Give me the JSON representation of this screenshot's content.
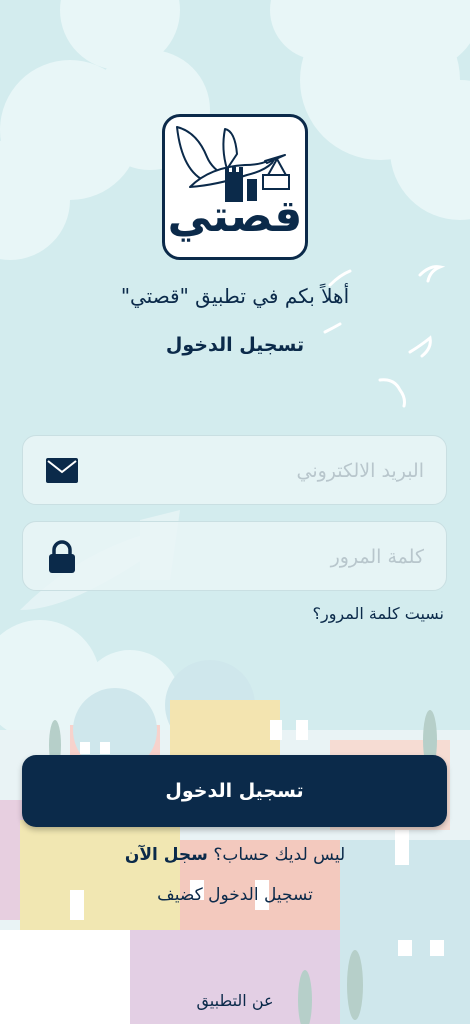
{
  "logo": {
    "text": "قصتي",
    "icon": "stork-carrying-book-logo"
  },
  "welcome_text": "أهلاً بكم في تطبيق \"قصتي\"",
  "login_title": "تسجيل الدخول",
  "email": {
    "placeholder": "البريد الالكتروني",
    "value": "",
    "icon": "envelope-icon"
  },
  "password": {
    "placeholder": "كلمة المرور",
    "value": "",
    "icon": "lock-icon"
  },
  "forgot_password": "نسيت كلمة المرور؟",
  "login_button": "تسجيل الدخول",
  "signup": {
    "prompt": "ليس لديك حساب؟",
    "link": "سجل الآن"
  },
  "guest_login": "تسجيل الدخول كضيف",
  "about_link": "عن التطبيق",
  "colors": {
    "primary": "#0b2a4a",
    "background": "#d3ecee"
  }
}
